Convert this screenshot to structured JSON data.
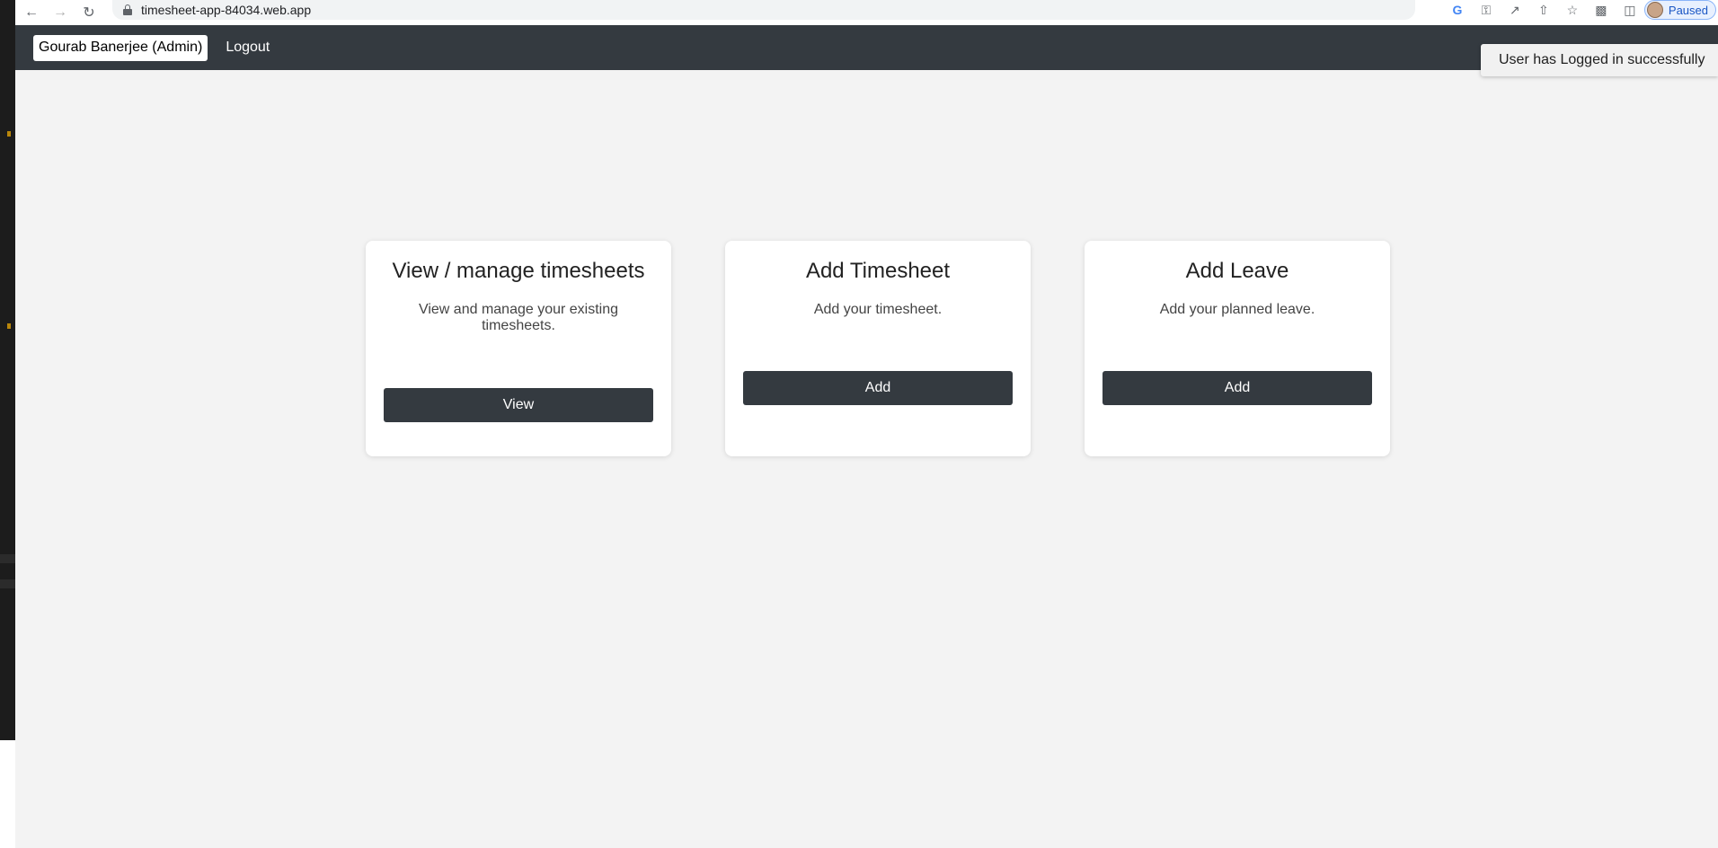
{
  "browser": {
    "url": "timesheet-app-84034.web.app",
    "profile_label": "Paused",
    "icons": [
      "back-icon",
      "forward-icon",
      "reload-icon",
      "lock-icon",
      "google-icon",
      "key-icon",
      "open-external-icon",
      "share-icon",
      "star-icon",
      "extensions-icon",
      "sidebar-icon"
    ]
  },
  "navbar": {
    "user_label": "Gourab Banerjee (Admin)",
    "logout_label": "Logout"
  },
  "toast": {
    "message": "User has Logged in successfully"
  },
  "cards": [
    {
      "title": "View / manage timesheets",
      "description": "View and manage your existing timesheets.",
      "button": "View"
    },
    {
      "title": "Add Timesheet",
      "description": "Add your timesheet.",
      "button": "Add"
    },
    {
      "title": "Add Leave",
      "description": "Add your planned leave.",
      "button": "Add"
    }
  ],
  "colors": {
    "navbar_bg": "#343a40",
    "page_bg": "#f3f3f3",
    "button_bg": "#343a40"
  }
}
